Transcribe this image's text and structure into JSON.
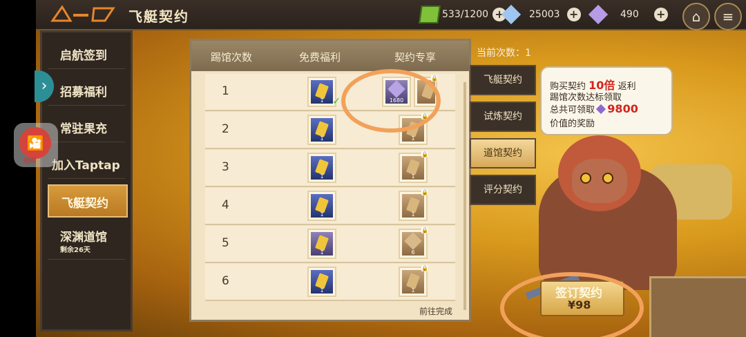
{
  "header": {
    "title": "飞艇契约",
    "stamina": "533/1200",
    "crystals": "25003",
    "gems": "490"
  },
  "nav": {
    "items": [
      {
        "label": "启航签到"
      },
      {
        "label": "招募福利"
      },
      {
        "label": "常驻果充"
      },
      {
        "label": "加入Taptap"
      },
      {
        "label": "飞艇契约"
      },
      {
        "label": "深渊道馆",
        "sub": "剩余26天"
      }
    ]
  },
  "table": {
    "col_visits": "踢馆次数",
    "col_free": "免费福利",
    "col_contract": "契约专享",
    "rows": [
      {
        "num": "1",
        "free_qty": "1",
        "contract_qty": "1680",
        "extra_qty": "1"
      },
      {
        "num": "2",
        "free_qty": "1",
        "contract_qty": "1"
      },
      {
        "num": "3",
        "free_qty": "1",
        "contract_qty": "1"
      },
      {
        "num": "4",
        "free_qty": "1",
        "contract_qty": "1"
      },
      {
        "num": "5",
        "free_qty": "1",
        "contract_qty": "6"
      },
      {
        "num": "6",
        "free_qty": "1",
        "contract_qty": "1"
      }
    ],
    "goto_done": "前往完成"
  },
  "side": {
    "current_count": "当前次数：1",
    "tabs": [
      "飞艇契约",
      "试炼契约",
      "道馆契约",
      "评分契约"
    ]
  },
  "bubble": {
    "line1a": "购买契约",
    "line1b": "10倍",
    "line1c": "返利",
    "line2": "踢馆次数达标领取",
    "line3a": "总共可领取",
    "line3b": "9800",
    "line4": "价值的奖励"
  },
  "sign": {
    "label": "签订契约",
    "price": "¥98"
  },
  "float_badge": "短视"
}
